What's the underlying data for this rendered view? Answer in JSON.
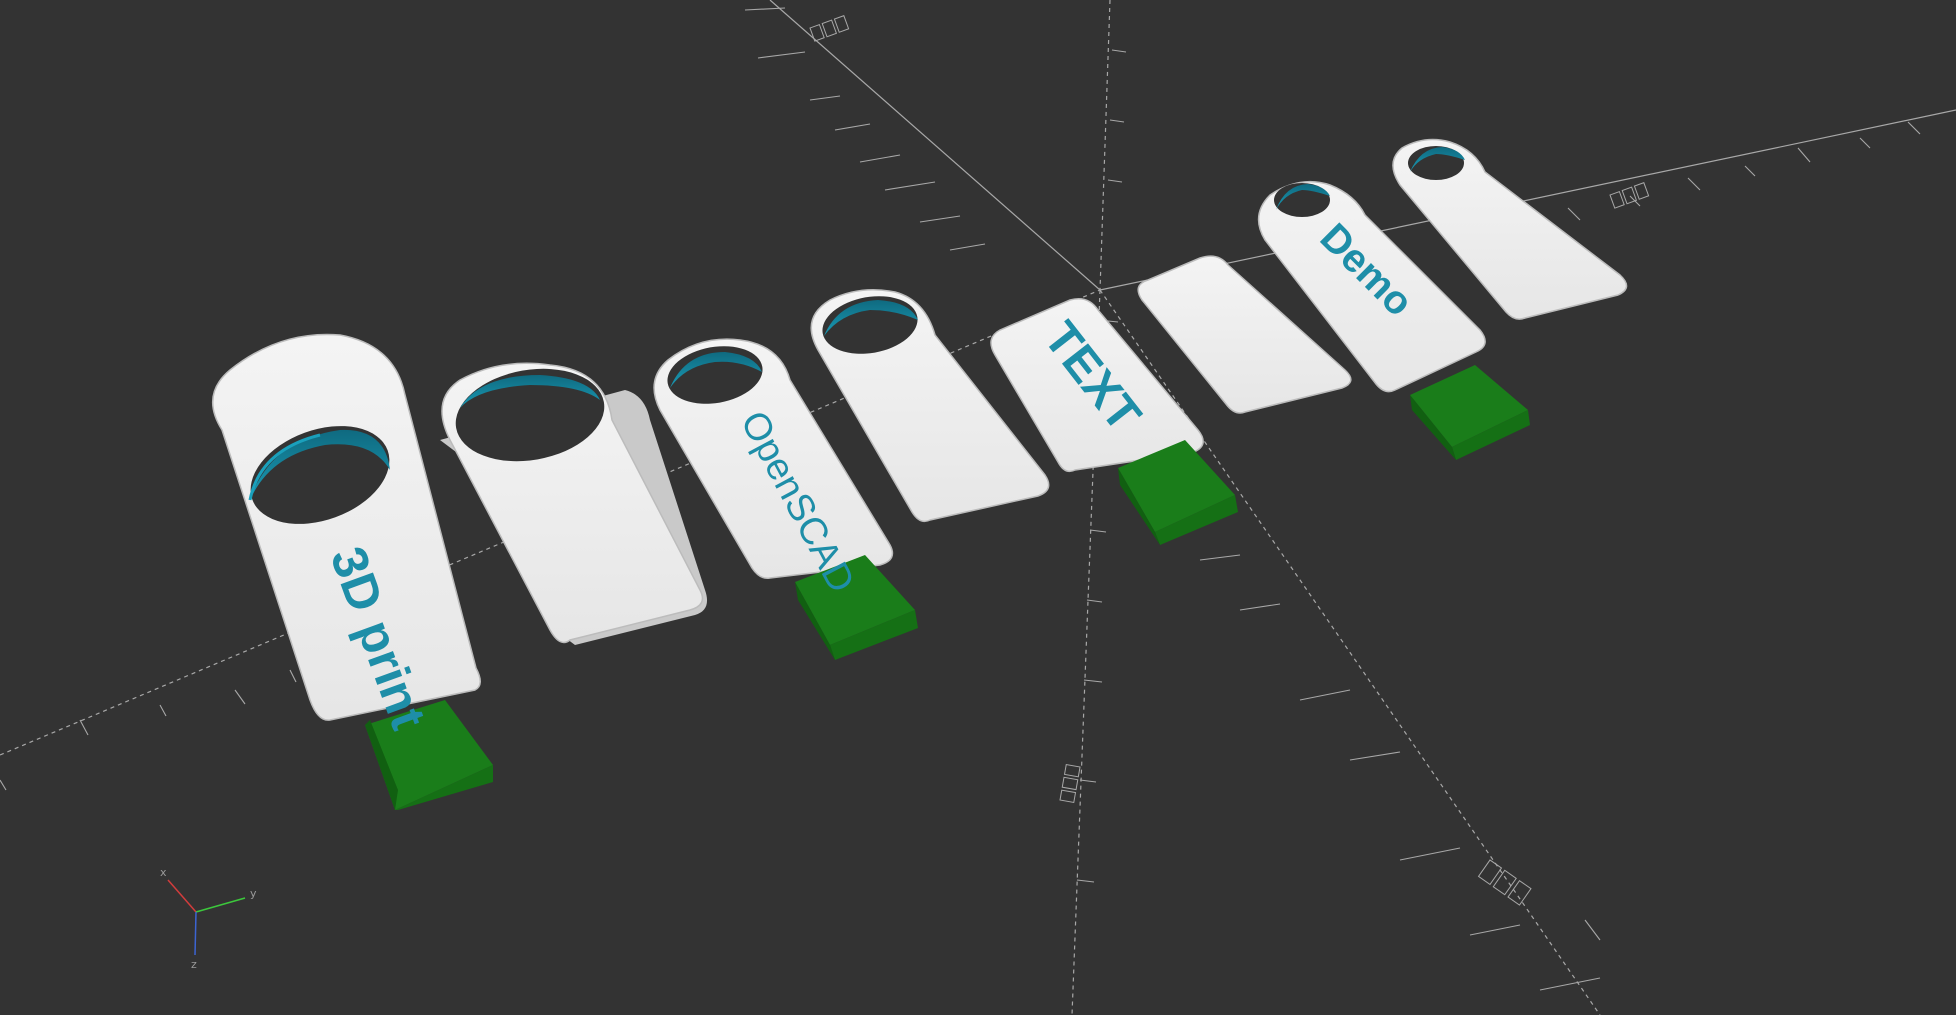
{
  "viewport": {
    "background": "#333333",
    "axis_color": "#a8a8a8",
    "key_body_color": "#f0f0f0",
    "key_edge_color": "#c9c9c9",
    "hole_color": "#137a93",
    "usb_plug_color": "#1f8a1f",
    "label_color": "#1e8ea8"
  },
  "models": [
    {
      "name": "key-3d-print",
      "label": "3D print",
      "has_usb": true
    },
    {
      "name": "key-blank-large",
      "label": "",
      "has_usb": false
    },
    {
      "name": "key-openscad",
      "label": "OpenSCAD",
      "has_usb": true
    },
    {
      "name": "key-blank-medium",
      "label": "",
      "has_usb": false
    },
    {
      "name": "key-text",
      "label": "TEXT",
      "has_usb": true
    },
    {
      "name": "key-blank-plain",
      "label": "",
      "has_usb": false
    },
    {
      "name": "key-demo",
      "label": "Demo",
      "has_usb": true
    },
    {
      "name": "key-blank-small",
      "label": "",
      "has_usb": false
    }
  ],
  "axis_indicator": {
    "x_label": "x",
    "y_label": "y",
    "z_label": "z",
    "x_color": "#d23c3c",
    "y_color": "#3cc83c",
    "z_color": "#3c64d2"
  }
}
